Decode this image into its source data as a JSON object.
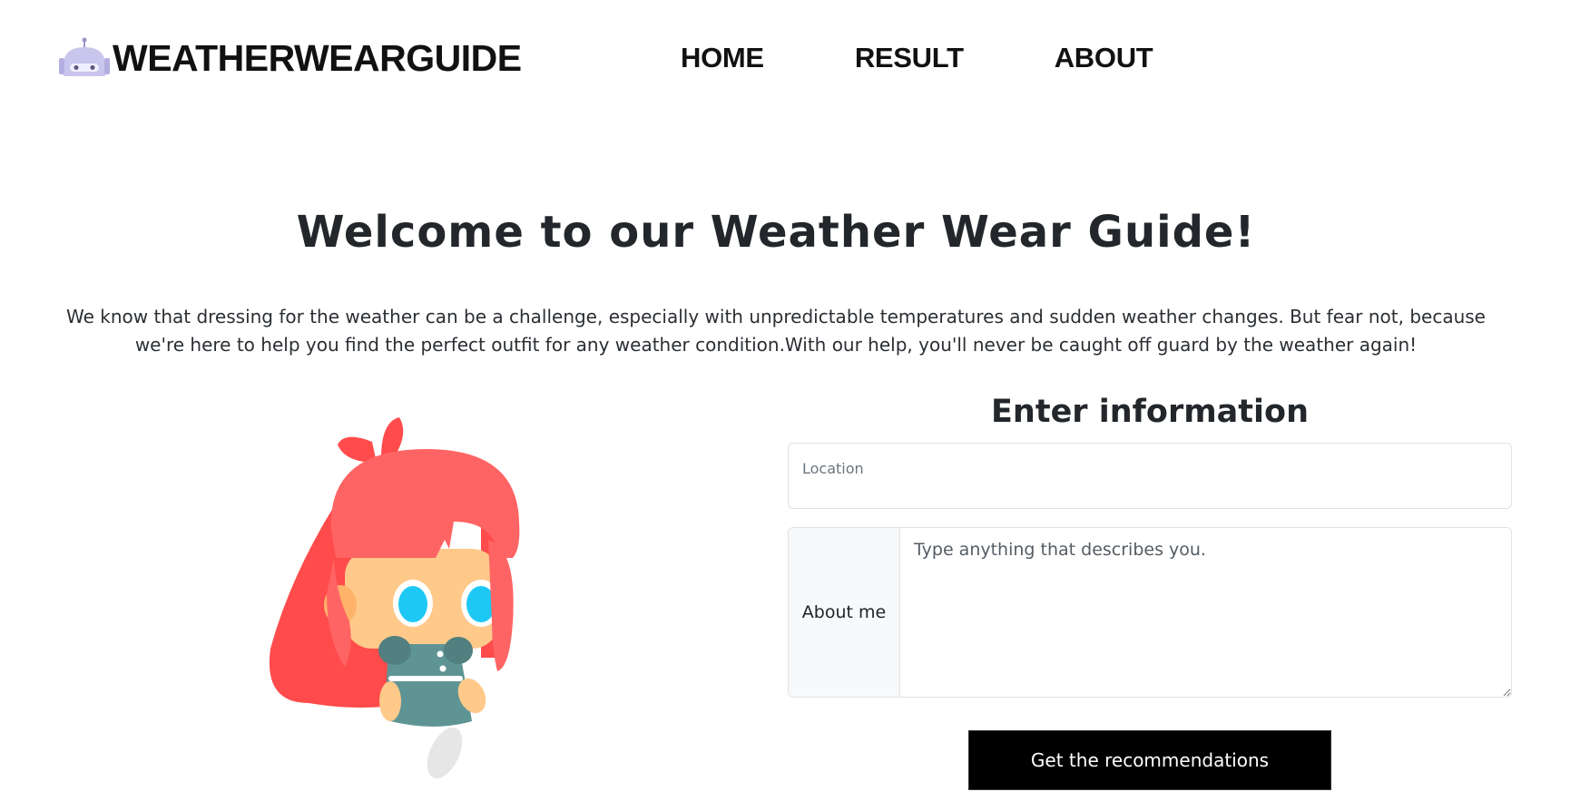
{
  "header": {
    "brand_name": "WEATHERWEARGUIDE",
    "logo_icon": "robot-icon",
    "nav": [
      {
        "label": "HOME"
      },
      {
        "label": "RESULT"
      },
      {
        "label": "ABOUT"
      }
    ]
  },
  "hero": {
    "title": "Welcome to our Weather Wear Guide!",
    "text": "We know that dressing for the weather can be a challenge, especially with unpredictable temperatures and sudden weather changes. But fear not, because we're here to help you find the perfect outfit for any weather condition.With our help, you'll never be caught off guard by the weather again!"
  },
  "form": {
    "title": "Enter information",
    "location_label": "Location",
    "location_value": "",
    "about_label": "About me",
    "about_placeholder": "Type anything that describes you.",
    "about_value": "",
    "submit_label": "Get the recommendations"
  },
  "colors": {
    "hair": "#ff5f5f",
    "eyes": "#1ec8f5",
    "dress": "#5f9494",
    "skin": "#ffc98a",
    "button": "#000000"
  }
}
